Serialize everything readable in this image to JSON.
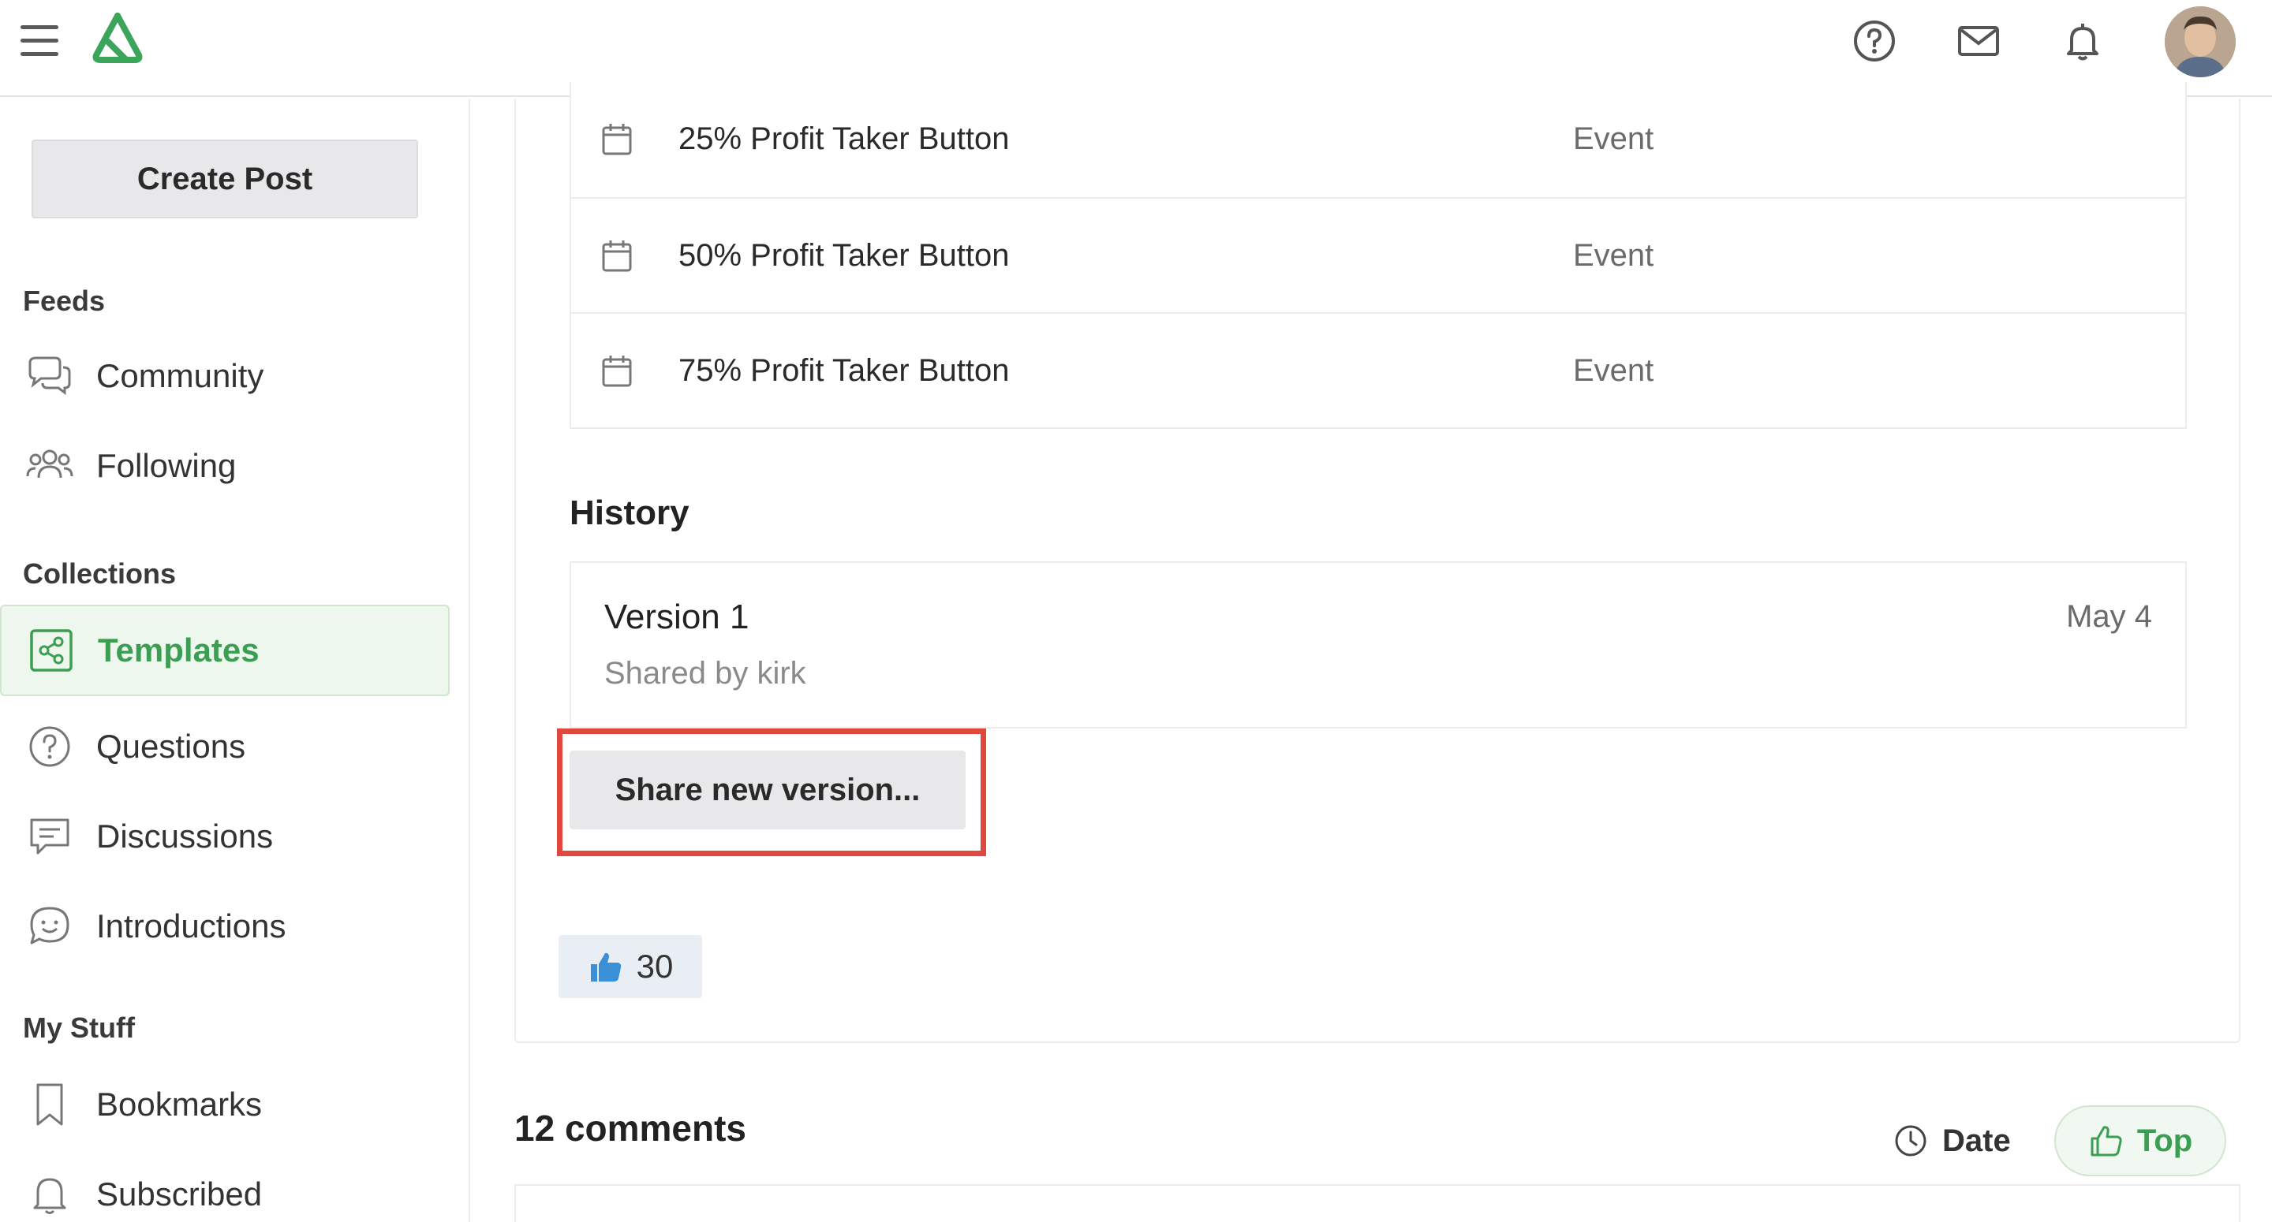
{
  "header": {
    "menu_icon": "hamburger-icon",
    "logo": "app-logo",
    "icons": [
      "help-icon",
      "mail-icon",
      "bell-icon"
    ],
    "avatar": "user-avatar"
  },
  "sidebar": {
    "create_post": "Create Post",
    "feeds_title": "Feeds",
    "feeds": [
      {
        "label": "Community",
        "icon": "chat-bubbles-icon"
      },
      {
        "label": "Following",
        "icon": "people-icon"
      }
    ],
    "collections_title": "Collections",
    "collections": [
      {
        "label": "Templates",
        "icon": "share-icon",
        "active": true
      },
      {
        "label": "Questions",
        "icon": "question-icon"
      },
      {
        "label": "Discussions",
        "icon": "message-icon"
      },
      {
        "label": "Introductions",
        "icon": "smile-icon"
      }
    ],
    "mystuff_title": "My Stuff",
    "mystuff": [
      {
        "label": "Bookmarks",
        "icon": "bookmark-icon"
      },
      {
        "label": "Subscribed",
        "icon": "bell-icon"
      }
    ]
  },
  "events": [
    {
      "name": "25% Profit Taker Button",
      "type": "Event"
    },
    {
      "name": "50% Profit Taker Button",
      "type": "Event"
    },
    {
      "name": "75% Profit Taker Button",
      "type": "Event"
    }
  ],
  "history": {
    "title": "History",
    "version": "Version 1",
    "date": "May 4",
    "shared_by": "Shared by kirk",
    "share_button": "Share new version..."
  },
  "likes": {
    "count": "30",
    "icon": "thumbs-up-icon"
  },
  "comments": {
    "title": "12 comments",
    "sort_date": "Date",
    "sort_top": "Top",
    "accent_color": "#3c9e52"
  }
}
